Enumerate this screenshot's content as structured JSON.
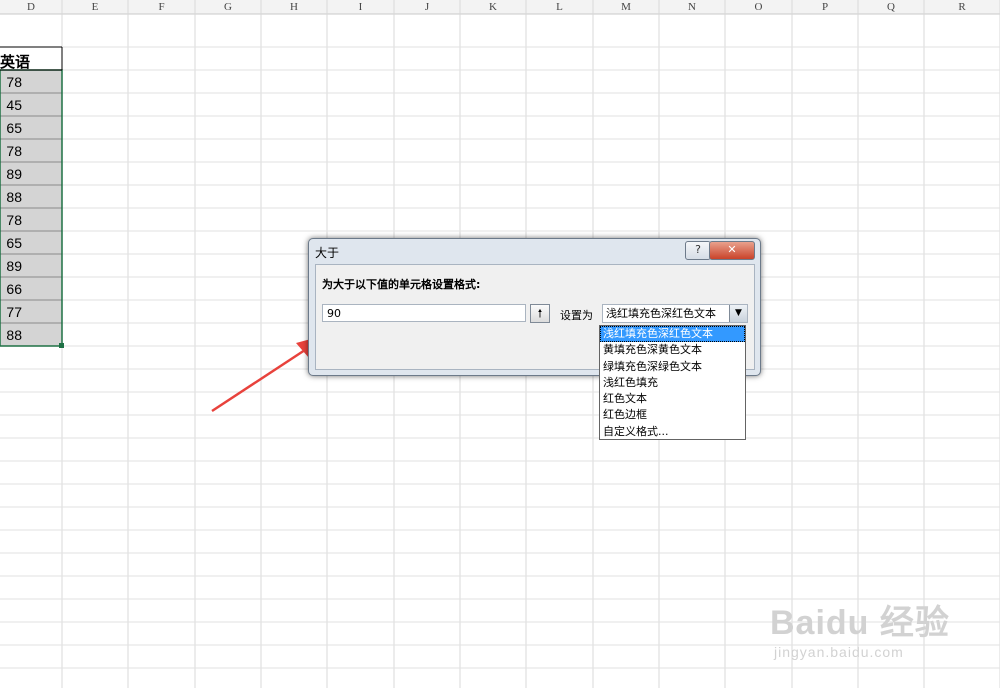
{
  "spreadsheet": {
    "columns": [
      "D",
      "E",
      "F",
      "G",
      "H",
      "I",
      "J",
      "K",
      "L",
      "M",
      "N",
      "O",
      "P",
      "Q",
      "R"
    ],
    "header_cell": "英语",
    "values": [
      "78",
      "45",
      "65",
      "78",
      "89",
      "88",
      "78",
      "65",
      "89",
      "66",
      "77",
      "88"
    ]
  },
  "dialog": {
    "title": "大于",
    "help_label": "?",
    "close_label": "✕",
    "prompt": "为大于以下值的单元格设置格式:",
    "input_value": "90",
    "set_as_label": "设置为",
    "selected_format": "浅红填充色深红色文本",
    "options": [
      "浅红填充色深红色文本",
      "黄填充色深黄色文本",
      "绿填充色深绿色文本",
      "浅红色填充",
      "红色文本",
      "红色边框",
      "自定义格式..."
    ]
  },
  "watermark": {
    "brand": "Baidu 经验",
    "url": "jingyan.baidu.com"
  },
  "colors": {
    "selection_fill": "#d4d4d4",
    "selection_border": "#1e7145",
    "annotation_arrow": "#e8423c",
    "dropdown_highlight": "#3399ff"
  }
}
